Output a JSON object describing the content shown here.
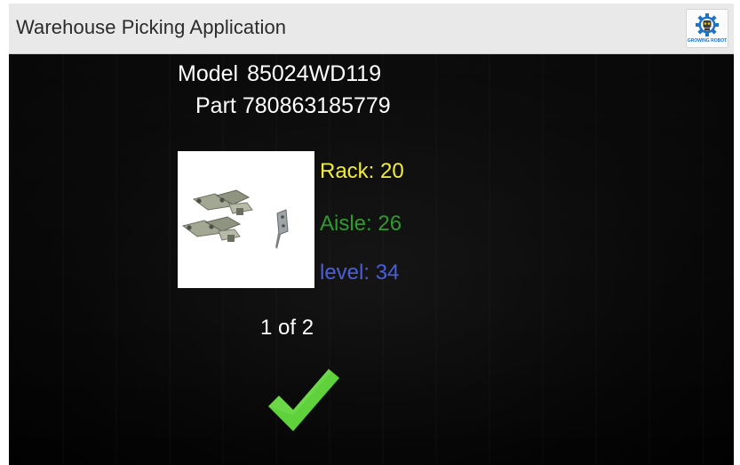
{
  "header": {
    "title": "Warehouse Picking Application",
    "logo_icon": "robot-gear-logo-icon",
    "logo_text": "GROWING ROBOT"
  },
  "item": {
    "model_label": "Model",
    "model_value": "85024WD119",
    "part_label": "Part",
    "part_value": "780863185779",
    "image_icon": "hinge-parts-image"
  },
  "location": {
    "rack_label": "Rack:",
    "rack_value": "20",
    "aisle_label": "Aisle:",
    "aisle_value": "26",
    "level_label": "level:",
    "level_value": "34"
  },
  "pager": {
    "current": "1",
    "separator": "of",
    "total": "2"
  },
  "actions": {
    "confirm_icon": "checkmark-icon"
  },
  "colors": {
    "rack": "#f2ee3a",
    "aisle": "#2f9b2f",
    "level": "#4a5fd8",
    "confirm": "#5fd13a",
    "header_bg": "#e9e9e9",
    "content_bg": "#000000"
  }
}
